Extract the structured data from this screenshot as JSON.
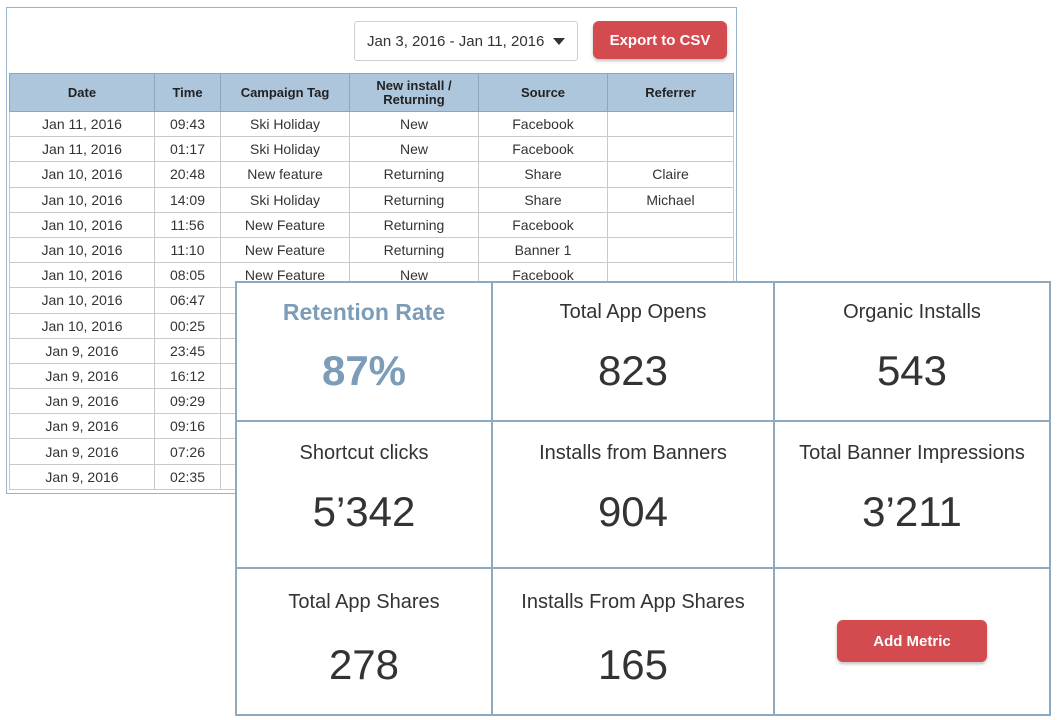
{
  "filters": {
    "date_range": "Jan 3, 2016 - Jan 11, 2016",
    "export_label": "Export to CSV"
  },
  "table": {
    "columns": [
      "Date",
      "Time",
      "Campaign Tag",
      "New install / Returning",
      "Source",
      "Referrer"
    ],
    "rows": [
      [
        "Jan 11, 2016",
        "09:43",
        "Ski Holiday",
        "New",
        "Facebook",
        ""
      ],
      [
        "Jan 11, 2016",
        "01:17",
        "Ski Holiday",
        "New",
        "Facebook",
        ""
      ],
      [
        "Jan 10, 2016",
        "20:48",
        "New feature",
        "Returning",
        "Share",
        "Claire"
      ],
      [
        "Jan 10, 2016",
        "14:09",
        "Ski Holiday",
        "Returning",
        "Share",
        "Michael"
      ],
      [
        "Jan 10, 2016",
        "11:56",
        "New Feature",
        "Returning",
        "Facebook",
        ""
      ],
      [
        "Jan 10, 2016",
        "11:10",
        "New Feature",
        "Returning",
        "Banner 1",
        ""
      ],
      [
        "Jan 10, 2016",
        "08:05",
        "New Feature",
        "New",
        "Facebook",
        ""
      ],
      [
        "Jan 10, 2016",
        "06:47",
        "",
        "",
        "",
        ""
      ],
      [
        "Jan 10, 2016",
        "00:25",
        "",
        "",
        "",
        ""
      ],
      [
        "Jan 9, 2016",
        "23:45",
        "",
        "",
        "",
        ""
      ],
      [
        "Jan 9, 2016",
        "16:12",
        "",
        "",
        "",
        ""
      ],
      [
        "Jan 9, 2016",
        "09:29",
        "",
        "",
        "",
        ""
      ],
      [
        "Jan 9, 2016",
        "09:16",
        "",
        "",
        "",
        ""
      ],
      [
        "Jan 9, 2016",
        "07:26",
        "",
        "",
        "",
        ""
      ],
      [
        "Jan 9, 2016",
        "02:35",
        "",
        "",
        "",
        ""
      ]
    ]
  },
  "metrics": [
    {
      "label": "Retention Rate",
      "value": "87%"
    },
    {
      "label": "Total App Opens",
      "value": "823"
    },
    {
      "label": "Organic Installs",
      "value": "543"
    },
    {
      "label": "Shortcut clicks",
      "value": "5’342"
    },
    {
      "label": "Installs from Banners",
      "value": "904"
    },
    {
      "label": "Total Banner Impressions",
      "value": "3’211"
    },
    {
      "label": "Total App Shares",
      "value": "278"
    },
    {
      "label": "Installs From App Shares",
      "value": "165"
    }
  ],
  "add_metric_label": "Add Metric",
  "colors": {
    "accent_button": "#d34a4f",
    "header_blue": "#aec6dc",
    "highlight_text": "#7d9cb8"
  }
}
